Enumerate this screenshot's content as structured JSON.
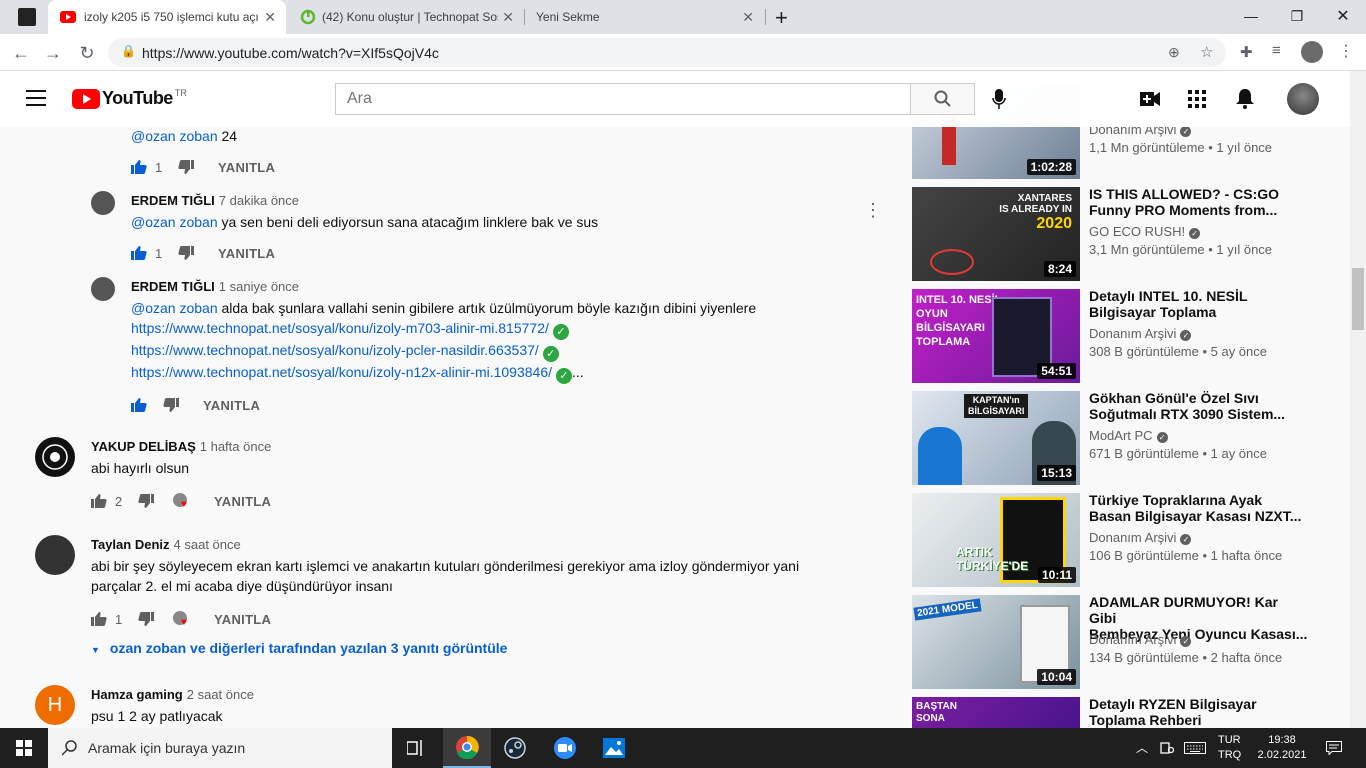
{
  "browser": {
    "tabs": [
      {
        "title": "izoly k205 i5 750 işlemci kutu açı",
        "active": true
      },
      {
        "title": "(42) Konu oluştur | Technopat Sos",
        "active": false
      },
      {
        "title": "Yeni Sekme",
        "active": false
      }
    ],
    "url": "https://www.youtube.com/watch?v=XIf5sQojV4c"
  },
  "masthead": {
    "logo_text": "YouTube",
    "region": "TR",
    "search_placeholder": "Ara"
  },
  "comments": [
    {
      "text_mention": "@ozan zoban",
      "text": " 24",
      "likes": "1",
      "reply": "YANITLA"
    },
    {
      "author": "ERDEM TIĞLI",
      "time": "7 dakika önce",
      "mention": "@ozan zoban",
      "text": " ya sen beni deli ediyorsun sana atacağım linklere bak ve sus",
      "likes": "1",
      "reply": "YANITLA"
    },
    {
      "author": "ERDEM TIĞLI",
      "time": "1 saniye önce",
      "mention": "@ozan zoban",
      "text": " alda bak şunlara vallahi senin gibilere artık üzülmüyorum böyle kazığın dibini yiyenlere",
      "links": [
        "https://www.technopat.net/sosyal/konu/izoly-m703-alinir-mi.815772/",
        "https://www.technopat.net/sosyal/konu/izoly-pcler-nasildir.663537/",
        "https://www.technopat.net/sosyal/konu/izoly-n12x-alinir-mi.1093846/"
      ],
      "ellipsis": "...",
      "reply": "YANITLA"
    },
    {
      "author": "YAKUP DELİBAŞ",
      "time": "1 hafta önce",
      "text": "abi hayırlı olsun",
      "likes": "2",
      "reply": "YANITLA"
    },
    {
      "author": "Taylan Deniz",
      "time": "4 saat önce",
      "text_line1": "abi bir şey söyleyecem ekran kartı işlemci ve anakartın kutuları gönderilmesi gerekiyor ama izloy göndermiyor yani",
      "text_line2": "parçalar 2. el mi acaba diye düşündürüyor insanı",
      "likes": "1",
      "reply": "YANITLA",
      "view_replies": "ozan zoban ve diğerleri tarafından yazılan 3 yanıtı görüntüle"
    },
    {
      "author": "Hamza gaming",
      "time": "2 saat önce",
      "avatar_letter": "H",
      "text": "psu 1 2 ay patlıyacak"
    }
  ],
  "sidebar": [
    {
      "title1": "",
      "title2": "",
      "channel": "Donanım Arşivi",
      "meta": "1,1 Mn görüntüleme • 1 yıl önce",
      "duration": "1:02:28"
    },
    {
      "title1": "IS THIS ALLOWED? - CS:GO",
      "title2": "Funny PRO Moments from...",
      "channel": "GO ECO RUSH!",
      "meta": "3,1 Mn görüntüleme • 1 yıl önce",
      "duration": "8:24",
      "thumb_text1": "XANTARES",
      "thumb_text2": "IS ALREADY IN",
      "thumb_text3": "2020"
    },
    {
      "title1": "Detaylı INTEL 10. NESİL",
      "title2": "Bilgisayar Toplama",
      "channel": "Donanım Arşivi",
      "meta": "308 B görüntüleme • 5 ay önce",
      "duration": "54:51",
      "thumb_text1": "INTEL 10. NESİL",
      "thumb_text2": "OYUN",
      "thumb_text3": "BİLGİSAYARI",
      "thumb_text4": "TOPLAMA"
    },
    {
      "title1": "Gökhan Gönül'e Özel Sıvı",
      "title2": "Soğutmalı RTX 3090 Sistem...",
      "channel": "ModArt PC",
      "meta": "671 B görüntüleme • 1 ay önce",
      "duration": "15:13",
      "thumb_text1": "KAPTAN'ın",
      "thumb_text2": "BİLGİSAYARI"
    },
    {
      "title1": "Türkiye Topraklarına Ayak",
      "title2": "Basan Bilgisayar Kasası NZXT...",
      "channel": "Donanım Arşivi",
      "meta": "106 B görüntüleme • 1 hafta önce",
      "duration": "10:11",
      "thumb_text1": "ARTIK",
      "thumb_text2": "TÜRKİYE'DE"
    },
    {
      "title1": "ADAMLAR DURMUYOR! Kar Gibi",
      "title2": "Bembeyaz Yeni Oyuncu Kasası...",
      "channel": "Donanım Arşivi",
      "meta": "134 B görüntüleme • 2 hafta önce",
      "duration": "10:04",
      "thumb_text1": "2021 MODEL"
    },
    {
      "title1": "Detaylı RYZEN Bilgisayar",
      "title2": "Toplama Rehberi",
      "thumb_text1": "BAŞTAN",
      "thumb_text2": "SONA"
    }
  ],
  "taskbar": {
    "search_placeholder": "Aramak için buraya yazın",
    "lang1": "TUR",
    "lang2": "TRQ",
    "time": "19:38",
    "date": "2.02.2021"
  },
  "colors": {
    "youtube_red": "#ff0000",
    "link_blue": "#065fd4",
    "taskbar": "#1f1f1f"
  }
}
